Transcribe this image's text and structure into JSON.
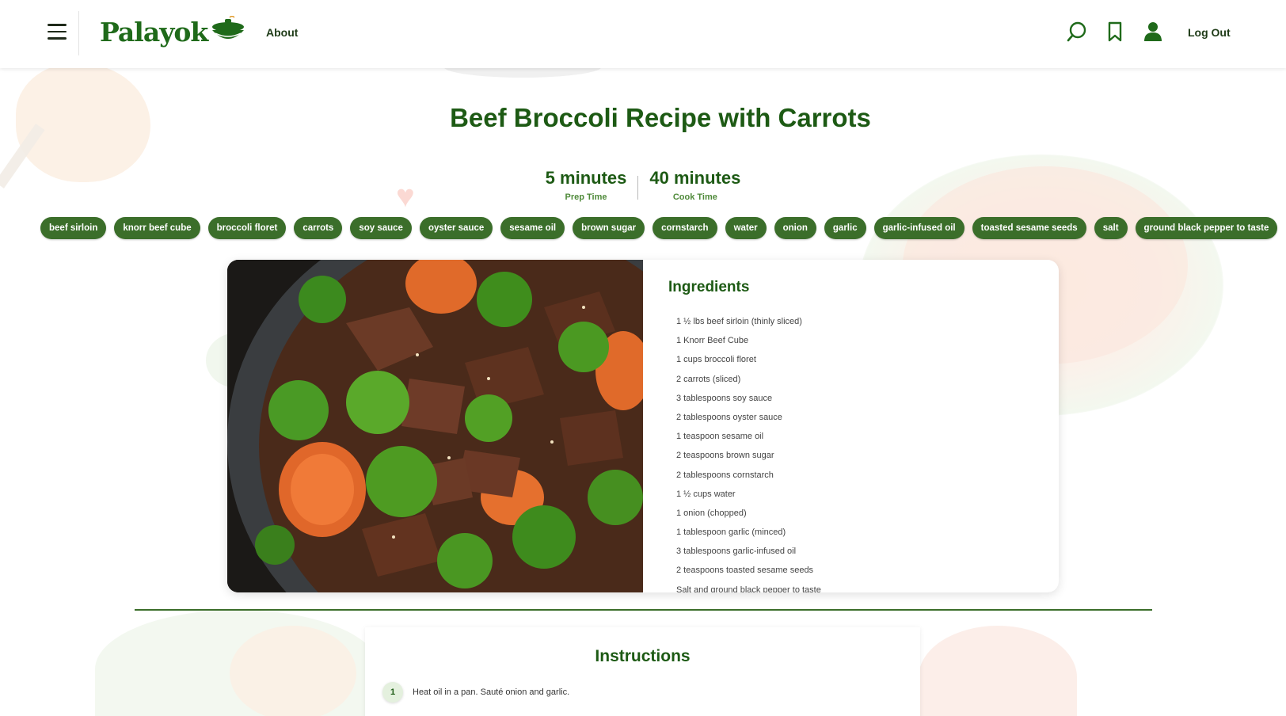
{
  "header": {
    "logo_text": "Palayok",
    "nav_about": "About",
    "logout": "Log Out",
    "icons": [
      "menu-icon",
      "search-icon",
      "bookmark-icon",
      "user-icon"
    ]
  },
  "recipe": {
    "title": "Beef Broccoli Recipe with Carrots",
    "prep_time": "5 minutes",
    "prep_label": "Prep Time",
    "cook_time": "40 minutes",
    "cook_label": "Cook Time"
  },
  "tags": [
    "beef sirloin",
    "knorr beef cube",
    "broccoli floret",
    "carrots",
    "soy sauce",
    "oyster sauce",
    "sesame oil",
    "brown sugar",
    "cornstarch",
    "water",
    "onion",
    "garlic",
    "garlic-infused oil",
    "toasted sesame seeds",
    "salt",
    "ground black pepper to taste"
  ],
  "ingredients": {
    "title": "Ingredients",
    "items": [
      "1 ½ lbs beef sirloin (thinly sliced)",
      "1 Knorr Beef Cube",
      "1 cups broccoli floret",
      "2 carrots (sliced)",
      "3 tablespoons soy sauce",
      "2 tablespoons oyster sauce",
      "1 teaspoon sesame oil",
      "2 teaspoons brown sugar",
      "2 tablespoons cornstarch",
      "1 ½ cups water",
      "1 onion (chopped)",
      "1 tablespoon garlic (minced)",
      "3 tablespoons garlic-infused oil",
      "2 teaspoons toasted sesame seeds",
      "Salt and ground black pepper to taste"
    ]
  },
  "instructions": {
    "title": "Instructions",
    "steps": [
      {
        "num": "1",
        "text": "Heat oil in a pan. Sauté onion and garlic."
      }
    ]
  },
  "colors": {
    "brand_green": "#1d5a14",
    "tag_green": "#3b6e2a"
  }
}
